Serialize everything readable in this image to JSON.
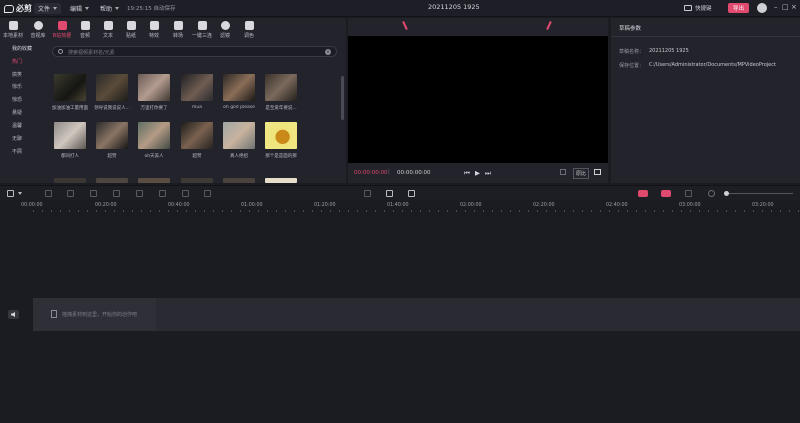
{
  "app": {
    "logo": "必剪"
  },
  "menu": {
    "file": "文件",
    "edit": "编辑",
    "help": "帮助",
    "autosave": "19:25:15 自动保存"
  },
  "project_title": "20211205 1925",
  "topright": {
    "shortcut": "快捷键",
    "export": "导出",
    "window_controls": [
      "–",
      "□",
      "×"
    ]
  },
  "toolbar": [
    {
      "label": "本地素材",
      "icon": "folder-icon"
    },
    {
      "label": "音视库",
      "icon": "face-icon"
    },
    {
      "label": "B站热梗",
      "icon": "tv-icon"
    },
    {
      "label": "音频",
      "icon": "music-icon"
    },
    {
      "label": "文本",
      "icon": "text-icon"
    },
    {
      "label": "贴纸",
      "icon": "sticker-icon"
    },
    {
      "label": "特效",
      "icon": "sparkle-icon"
    },
    {
      "label": "转场",
      "icon": "transition-icon"
    },
    {
      "label": "一键三连",
      "icon": "thumb-icon"
    },
    {
      "label": "滤镜",
      "icon": "palette-icon"
    },
    {
      "label": "调色",
      "icon": "adjust-icon"
    }
  ],
  "categories": [
    "我的收藏",
    "热门",
    "搞笑",
    "惊乐",
    "惊恐",
    "悬疑",
    "温馨",
    "无聊",
    "不屑"
  ],
  "search": {
    "placeholder": "搜索视频素材名/元素"
  },
  "media_items": [
    {
      "label": "加油加油工量用面"
    },
    {
      "label": "领导说我说说人..."
    },
    {
      "label": "万里打你要了"
    },
    {
      "label": "mua"
    },
    {
      "label": "oh god please"
    },
    {
      "label": "是至爱年要说..."
    },
    {
      "label": "都同打人"
    },
    {
      "label": "超赞"
    },
    {
      "label": "oh天美人"
    },
    {
      "label": "超赞"
    },
    {
      "label": "真人绝招"
    },
    {
      "label": "那个是是面的那"
    }
  ],
  "preview": {
    "current_time": "00:00:00:00",
    "total_time": "00:00:00:00",
    "ratio": "原比"
  },
  "properties": {
    "title": "草稿参数",
    "name_label": "草稿名称：",
    "name_value": "20211205 1925",
    "path_label": "保存位置：",
    "path_value": "C:/Users/Administrator/Documents/MPVideoProject"
  },
  "ruler": [
    "00:00:00",
    "00:20:00",
    "00:40:00",
    "01:00:00",
    "01:20:00",
    "01:40:00",
    "02:00:00",
    "02:20:00",
    "02:40:00",
    "03:00:00",
    "03:20:00"
  ],
  "track": {
    "hint": "拖拽素材到这里，开始你的创作吧"
  },
  "colors": {
    "accent": "#e04a6f",
    "bg": "#1b1b22",
    "panel": "#23232b"
  }
}
